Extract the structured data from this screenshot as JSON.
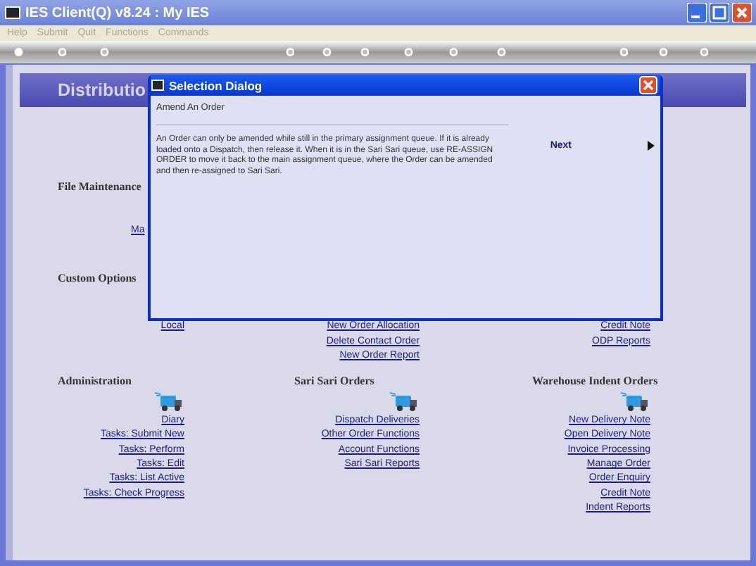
{
  "window": {
    "title": "IES Client(Q) v8.24 : My IES"
  },
  "menu": [
    "Help",
    "Submit",
    "Quit",
    "Functions",
    "Commands"
  ],
  "banner": {
    "title": "Distributio"
  },
  "file_maintenance": {
    "heading": "File Maintenance",
    "links": [
      "Ma"
    ]
  },
  "custom_options": {
    "heading": "Custom Options",
    "columns": [
      [
        "Local"
      ],
      [
        "New Order Allocation",
        "Delete Contact Order",
        "New Order Report"
      ],
      [
        "Credit Note",
        "ODP Reports"
      ]
    ]
  },
  "groups": [
    {
      "heading": "Administration",
      "links": [
        "Diary",
        "Tasks: Submit New",
        "Tasks: Perform",
        "Tasks: Edit",
        "Tasks: List Active",
        "Tasks: Check Progress"
      ]
    },
    {
      "heading": "Sari Sari Orders",
      "links": [
        "Dispatch Deliveries",
        "Other Order Functions",
        "Account Functions",
        "Sari Sari Reports"
      ]
    },
    {
      "heading": "Warehouse Indent Orders",
      "links": [
        "New Delivery Note",
        "Open Delivery Note",
        "Invoice Processing",
        "Manage Order",
        "Order Enquiry",
        "Credit Note",
        "Indent Reports"
      ]
    }
  ],
  "dialog": {
    "title": "Selection Dialog",
    "heading": "Amend An Order",
    "text": "An Order can only be amended while still in the primary assignment queue. If it is already loaded onto a Dispatch, then release it. When it is in the Sari Sari queue, use RE-ASSIGN ORDER to move it back to the main assignment queue, where the Order can be amended and then re-assigned to Sari Sari.",
    "next": "Next"
  }
}
